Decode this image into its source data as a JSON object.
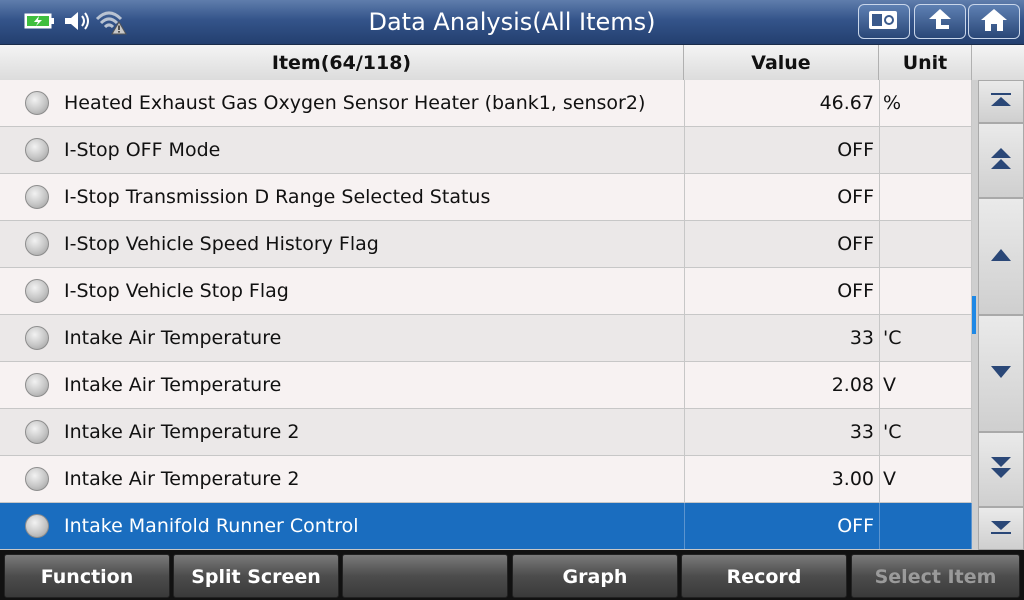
{
  "title": "Data Analysis(All Items)",
  "status": {
    "battery": "battery-charging-icon",
    "volume": "speaker-icon",
    "wifi": "wifi-warning-icon"
  },
  "toolbar": {
    "screenshot": "camera-icon",
    "back": "back-arrow-icon",
    "home": "home-icon"
  },
  "table": {
    "columns": {
      "item": "Item(64/118)",
      "value": "Value",
      "unit": "Unit"
    },
    "rows": [
      {
        "name": "Heated Exhaust Gas Oxygen Sensor Heater (bank1, sensor2)",
        "value": "46.67",
        "unit": "%"
      },
      {
        "name": "I-Stop OFF Mode",
        "value": "OFF",
        "unit": ""
      },
      {
        "name": "I-Stop Transmission D Range Selected Status",
        "value": "OFF",
        "unit": ""
      },
      {
        "name": "I-Stop Vehicle Speed History Flag",
        "value": "OFF",
        "unit": ""
      },
      {
        "name": "I-Stop Vehicle Stop Flag",
        "value": "OFF",
        "unit": ""
      },
      {
        "name": "Intake Air Temperature",
        "value": "33",
        "unit": "'C"
      },
      {
        "name": "Intake Air Temperature",
        "value": "2.08",
        "unit": "V"
      },
      {
        "name": "Intake Air Temperature 2",
        "value": "33",
        "unit": "'C"
      },
      {
        "name": "Intake Air Temperature 2",
        "value": "3.00",
        "unit": "V"
      },
      {
        "name": "Intake Manifold Runner Control",
        "value": "OFF",
        "unit": ""
      }
    ],
    "selected_index": 9
  },
  "scroll_buttons": [
    "scroll-top-icon",
    "page-up-icon",
    "line-up-icon",
    "line-down-icon",
    "page-down-icon",
    "scroll-bottom-icon"
  ],
  "bottom": {
    "function": "Function",
    "split": "Split Screen",
    "blank": "",
    "graph": "Graph",
    "record": "Record",
    "select": "Select Item"
  },
  "colors": {
    "selected_row": "#1a6dbf",
    "titlebar": "#34548a",
    "scroll_thumb": "#1e88e5"
  }
}
